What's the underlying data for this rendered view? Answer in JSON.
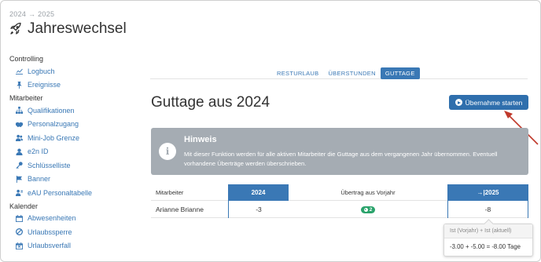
{
  "breadcrumb": "2024 → 2025",
  "app": {
    "title": "Jahreswechsel",
    "icon": "rocket-icon"
  },
  "sidebar": {
    "sections": [
      {
        "label": "Controlling",
        "items": [
          {
            "label": "Logbuch",
            "icon": "chart-line-icon"
          },
          {
            "label": "Ereignisse",
            "icon": "pin-icon"
          }
        ]
      },
      {
        "label": "Mitarbeiter",
        "items": [
          {
            "label": "Qualifikationen",
            "icon": "org-chart-icon"
          },
          {
            "label": "Personalzugang",
            "icon": "handshake-icon"
          },
          {
            "label": "Mini-Job Grenze",
            "icon": "users-icon"
          },
          {
            "label": "e2n ID",
            "icon": "user-icon"
          },
          {
            "label": "Schlüsselliste",
            "icon": "key-icon"
          },
          {
            "label": "Banner",
            "icon": "flag-icon"
          },
          {
            "label": "eAU Personaltabelle",
            "icon": "user-table-icon"
          }
        ]
      },
      {
        "label": "Kalender",
        "items": [
          {
            "label": "Abwesenheiten",
            "icon": "calendar-icon"
          },
          {
            "label": "Urlaubssperre",
            "icon": "ban-icon"
          },
          {
            "label": "Urlaubsverfall",
            "icon": "calendar-x-icon"
          }
        ]
      }
    ]
  },
  "tabs": [
    {
      "label": "RESTURLAUB",
      "active": false
    },
    {
      "label": "ÜBERSTUNDEN",
      "active": false
    },
    {
      "label": "GUTTAGE",
      "active": true
    }
  ],
  "main": {
    "title": "Guttage aus 2024",
    "start_button": "Übernahme starten"
  },
  "hint": {
    "title": "Hinweis",
    "icon_glyph": "i",
    "text": "Mit dieser Funktion werden für alle aktiven Mitarbeiter die Guttage aus dem vergangenen Jahr übernommen. Eventuell vorhandene Überträge werden überschrieben."
  },
  "table": {
    "headers": {
      "employee": "Mitarbeiter",
      "year_prev": "2024",
      "carry": "Übertrag aus Vorjahr",
      "year_next": "→|2025"
    },
    "rows": [
      {
        "employee": "Arianne Brianne",
        "prev": "-3",
        "carry_badge": "2",
        "next": "-8"
      }
    ]
  },
  "tooltip": {
    "header": "Ist (Vorjahr) + Ist (aktuell)",
    "body": "-3.00 + -5.00 = -8.00 Tage"
  },
  "colors": {
    "accent": "#3a78b5",
    "button": "#2f6fad",
    "hint_bg": "#a5acb3",
    "badge": "#2aa36b",
    "arrow": "#c0392b"
  }
}
